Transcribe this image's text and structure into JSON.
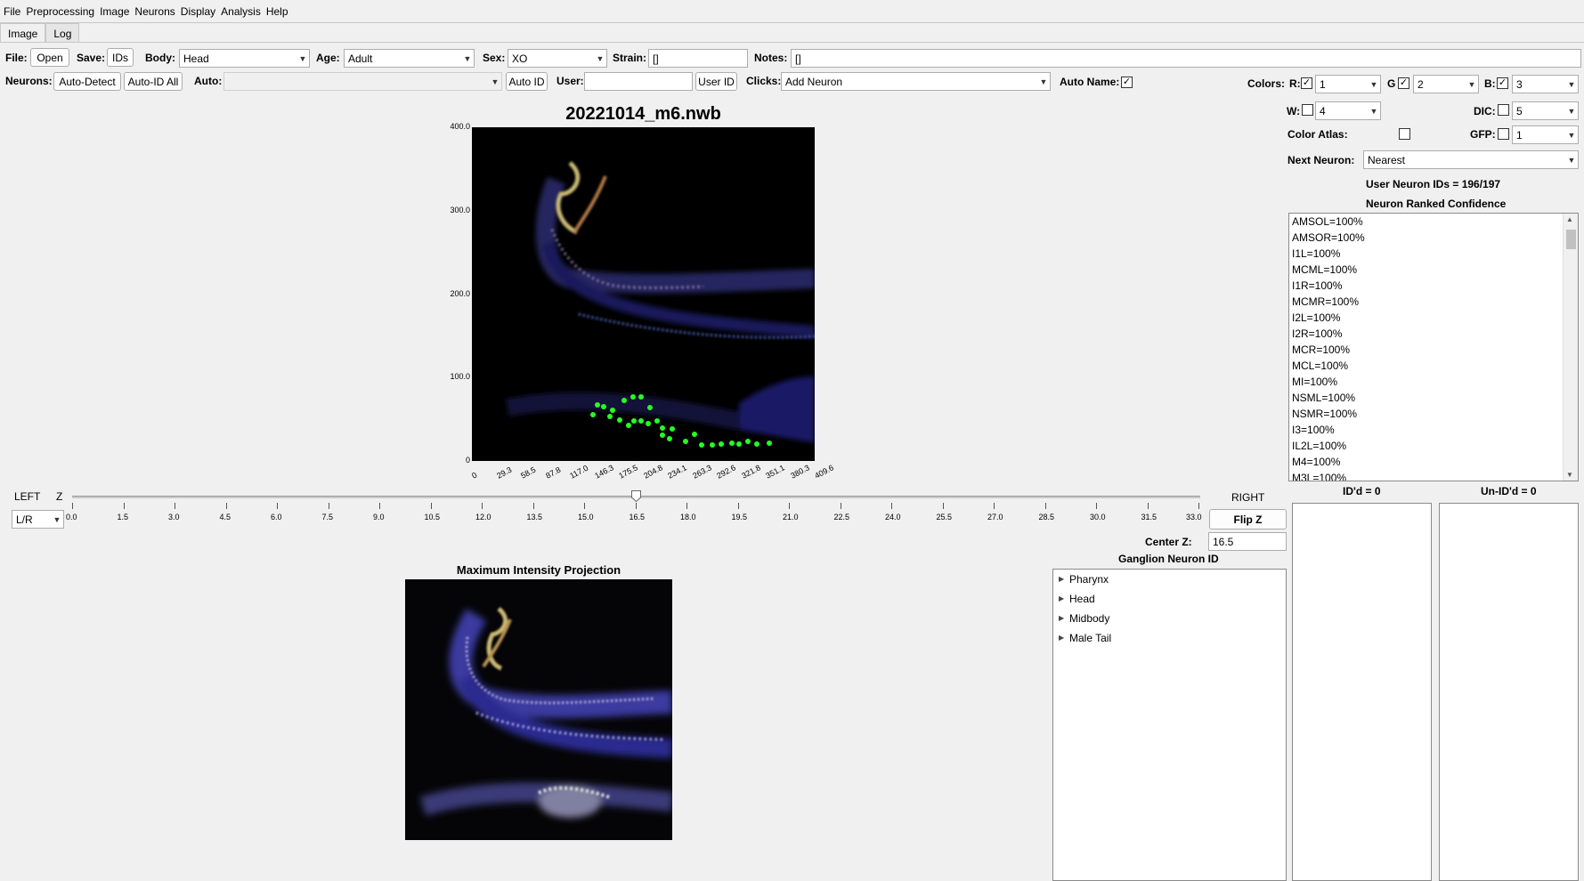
{
  "menu": [
    "File",
    "Preprocessing",
    "Image",
    "Neurons",
    "Display",
    "Analysis",
    "Help"
  ],
  "tabs": [
    "Image",
    "Log"
  ],
  "toolbar": {
    "file_label": "File:",
    "open_label": "Open",
    "save_label": "Save:",
    "ids_label": "IDs",
    "body_label": "Body:",
    "body_value": "Head",
    "age_label": "Age:",
    "age_value": "Adult",
    "sex_label": "Sex:",
    "sex_value": "XO",
    "strain_label": "Strain:",
    "strain_value": "[]",
    "notes_label": "Notes:",
    "notes_value": "[]",
    "neurons_label": "Neurons:",
    "auto_detect_label": "Auto-Detect",
    "auto_id_all_label": "Auto-ID All",
    "auto_label": "Auto:",
    "auto_value": "",
    "auto_id_label": "Auto ID",
    "user_label": "User:",
    "user_value": "",
    "user_id_label": "User ID",
    "clicks_label": "Clicks:",
    "clicks_value": "Add Neuron",
    "auto_name_label": "Auto Name:",
    "auto_name_checked": true
  },
  "colors": {
    "colors_label": "Colors:",
    "r_label": "R:",
    "r_checked": true,
    "r_value": "1",
    "g_label": "G",
    "g_checked": true,
    "g_value": "2",
    "b_label": "B:",
    "b_checked": true,
    "b_value": "3",
    "w_label": "W:",
    "w_checked": false,
    "w_value": "4",
    "dic_label": "DIC:",
    "dic_checked": false,
    "dic_value": "5",
    "atlas_label": "Color Atlas:",
    "atlas_checked": false,
    "gfp_label": "GFP:",
    "gfp_checked": false,
    "gfp_value": "1",
    "next_neuron_label": "Next Neuron:",
    "next_neuron_value": "Nearest"
  },
  "image_view": {
    "title": "20221014_m6.nwb",
    "y_ticks": [
      "400.0",
      "300.0",
      "200.0",
      "100.0",
      "0"
    ],
    "x_ticks": [
      "0",
      "29.3",
      "58.5",
      "87.8",
      "117.0",
      "146.3",
      "175.5",
      "204.8",
      "234.1",
      "263.3",
      "292.6",
      "321.8",
      "351.1",
      "380.3",
      "409.6"
    ]
  },
  "z_slider": {
    "left_label": "LEFT",
    "z_label": "Z",
    "right_label": "RIGHT",
    "lr_value": "L/R",
    "ticks": [
      "0.0",
      "1.5",
      "3.0",
      "4.5",
      "6.0",
      "7.5",
      "9.0",
      "10.5",
      "12.0",
      "13.5",
      "15.0",
      "16.5",
      "18.0",
      "19.5",
      "21.0",
      "22.5",
      "24.0",
      "25.5",
      "27.0",
      "28.5",
      "30.0",
      "31.5",
      "33.0"
    ],
    "value": 16.5,
    "min": 0,
    "max": 33,
    "flip_label": "Flip Z",
    "center_label": "Center Z:",
    "center_value": "16.5"
  },
  "mip": {
    "title": "Maximum Intensity Projection"
  },
  "ganglion": {
    "title": "Ganglion Neuron ID",
    "items": [
      "Pharynx",
      "Head",
      "Midbody",
      "Male Tail"
    ]
  },
  "neuron_panel": {
    "user_ids": "User Neuron IDs = 196/197",
    "ranked_title": "Neuron Ranked Confidence",
    "ranked": [
      "AMSOL=100%",
      "AMSOR=100%",
      "I1L=100%",
      "MCML=100%",
      "I1R=100%",
      "MCMR=100%",
      "I2L=100%",
      "I2R=100%",
      "MCR=100%",
      "MCL=100%",
      "MI=100%",
      "NSML=100%",
      "NSMR=100%",
      "I3=100%",
      "IL2L=100%",
      "M4=100%",
      "M3L=100%"
    ],
    "idd_label": "ID'd = 0",
    "unidd_label": "Un-ID'd = 0"
  }
}
